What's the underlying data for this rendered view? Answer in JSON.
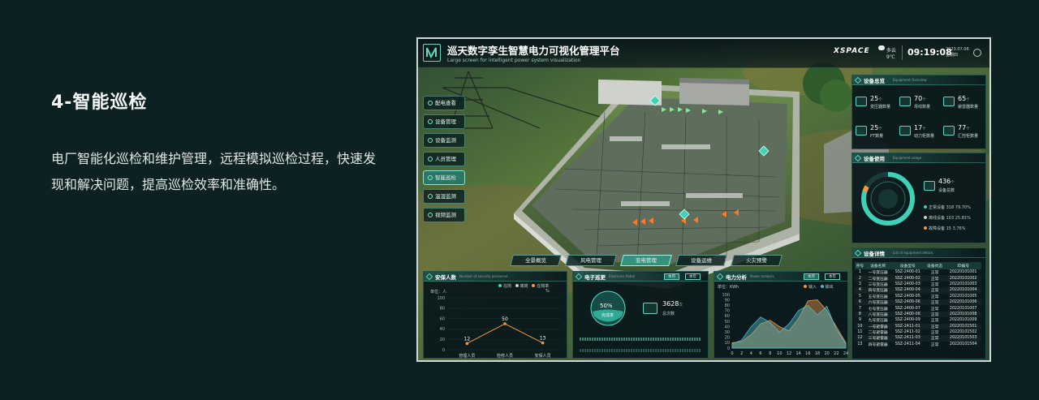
{
  "intro": {
    "title": "4-智能巡检",
    "description": "电厂智能化巡检和维护管理，远程模拟巡检过程，快速发现和解决问题，提高巡检效率和准确性。"
  },
  "header": {
    "title": "巡天数字孪生智慧电力可视化管理平台",
    "subtitle": "Large screen for intelligent power system visualization",
    "brand": "XSPACE",
    "weather": "多云",
    "temperature": "9℃",
    "time": "09:19:08",
    "date": "2023.07.06",
    "weekday": "星期四"
  },
  "nav": {
    "items": [
      {
        "label": "配电查看"
      },
      {
        "label": "设备管理"
      },
      {
        "label": "设备监测"
      },
      {
        "label": "人员管理"
      },
      {
        "label": "智能巡检",
        "active": true
      },
      {
        "label": "温湿监测"
      },
      {
        "label": "视频监测"
      }
    ]
  },
  "tabs": [
    {
      "label": "全景概览"
    },
    {
      "label": "风电管理"
    },
    {
      "label": "变电管理",
      "active": true
    },
    {
      "label": "设备运维"
    },
    {
      "label": "火灾预警"
    }
  ],
  "overview": {
    "title": "设备总览",
    "en": "Equipment Overview",
    "items": [
      {
        "value": "25",
        "unit": "个",
        "label": "变压器数量"
      },
      {
        "value": "70",
        "unit": "个",
        "label": "母线数量"
      },
      {
        "value": "65",
        "unit": "个",
        "label": "避雷器数量"
      },
      {
        "value": "25",
        "unit": "个",
        "label": "PT数量"
      },
      {
        "value": "17",
        "unit": "个",
        "label": "动力柜数量"
      },
      {
        "value": "77",
        "unit": "个",
        "label": "汇控柜数量"
      }
    ]
  },
  "usage": {
    "title": "设备使用",
    "en": "Equipment usage",
    "total_value": "436",
    "total_unit": "个",
    "total_label": "设备总数",
    "rows": [
      {
        "label": "正常设备",
        "count": "318",
        "pct": "79.70%",
        "color": "#3fd1b8"
      },
      {
        "label": "离线设备",
        "count": "103",
        "pct": "25.81%",
        "color": "#c9d4d2"
      },
      {
        "label": "故障设备",
        "count": "15",
        "pct": "3.76%",
        "color": "#f39a3c"
      }
    ]
  },
  "details": {
    "title": "设备详情",
    "en": "List of equipment details",
    "headers": [
      "序号",
      "设备名称",
      "设备型号",
      "设备状态",
      "ID编号"
    ],
    "rows": [
      [
        "1",
        "一号变压器",
        "SSZ-2400-01",
        "正常",
        "20220101001"
      ],
      [
        "2",
        "二号变压器",
        "SSZ-2400-02",
        "正常",
        "20220101002"
      ],
      [
        "3",
        "三号变压器",
        "SSZ-2400-03",
        "正常",
        "20220101003"
      ],
      [
        "4",
        "四号变压器",
        "SSZ-2400-04",
        "正常",
        "20220101004"
      ],
      [
        "5",
        "五号变压器",
        "SSZ-2400-05",
        "正常",
        "20220101005"
      ],
      [
        "6",
        "六号变压器",
        "SSZ-2400-06",
        "正常",
        "20220101006"
      ],
      [
        "7",
        "七号变压器",
        "SSZ-2400-07",
        "正常",
        "20220101007"
      ],
      [
        "8",
        "八号变压器",
        "SSZ-2400-08",
        "正常",
        "20220101008"
      ],
      [
        "9",
        "九号变压器",
        "SSZ-2400-09",
        "正常",
        "20220101009"
      ],
      [
        "10",
        "一号避雷器",
        "SSZ-2411-01",
        "正常",
        "20220101501"
      ],
      [
        "11",
        "二号避雷器",
        "SSZ-2411-02",
        "正常",
        "20220101502"
      ],
      [
        "12",
        "三号避雷器",
        "SSZ-2411-03",
        "正常",
        "20220101503"
      ],
      [
        "13",
        "四号避雷器",
        "SSZ-2411-04",
        "正常",
        "20220101504"
      ]
    ]
  },
  "staff": {
    "title": "安保人数",
    "en": "Number of security personnel",
    "unit_label": "单位：人",
    "legend": [
      {
        "label": "在岗",
        "color": "#3fd1b8"
      },
      {
        "label": "离岗",
        "color": "#c9d4d2"
      },
      {
        "label": "在岗率",
        "color": "#f39a3c"
      }
    ],
    "pct_label": "%"
  },
  "patrol": {
    "title": "电子巡更",
    "en": "Electronic Patrol",
    "btn_month": "本月",
    "btn_year": "本年",
    "percent": "50%",
    "percent_label": "完成率",
    "count": "3628",
    "count_unit": "次",
    "count_label": "总次数"
  },
  "power": {
    "title": "电力分析",
    "en": "Power analysis",
    "btn_month": "本月",
    "btn_year": "本年",
    "unit_label": "单位：KWh",
    "legend": [
      {
        "label": "输入",
        "color": "#e89a4a"
      },
      {
        "label": "输出",
        "color": "#4fb7c8"
      }
    ]
  },
  "chart_data": [
    {
      "type": "line",
      "categories": [
        "管理人员",
        "检修人员",
        "安保人员"
      ],
      "values": [
        12,
        50,
        13
      ],
      "ylim": [
        0,
        100
      ],
      "yticks": [
        0,
        20,
        40,
        60,
        80,
        100
      ],
      "ylabel": "单位：人",
      "color": "#f39a3c"
    },
    {
      "type": "area",
      "x": [
        0,
        2,
        4,
        6,
        8,
        10,
        12,
        14,
        16,
        18,
        20,
        22,
        24
      ],
      "ylim": [
        0,
        100
      ],
      "yticks": [
        0,
        10,
        20,
        30,
        40,
        50,
        60,
        70,
        80,
        90,
        100
      ],
      "xticks": [
        "0",
        "2",
        "4",
        "6",
        "8",
        "10",
        "12",
        "14",
        "16",
        "18",
        "20",
        "22",
        "24"
      ],
      "ylabel": "单位：KWh",
      "series": [
        {
          "name": "输入",
          "values": [
            10,
            12,
            25,
            45,
            52,
            40,
            32,
            55,
            88,
            90,
            70,
            40,
            10
          ],
          "color": "#e89a4a"
        },
        {
          "name": "输出",
          "values": [
            8,
            15,
            40,
            58,
            48,
            30,
            45,
            70,
            80,
            62,
            78,
            35,
            8
          ],
          "color": "#4fb7c8"
        }
      ]
    }
  ]
}
